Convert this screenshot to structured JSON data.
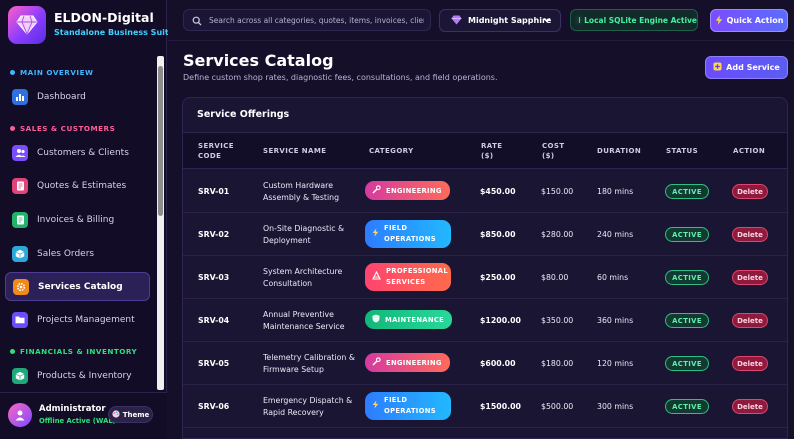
{
  "brand": {
    "name": "ELDON-Digital",
    "subtitle": "Standalone Business Suite"
  },
  "sidebar": {
    "sections": [
      {
        "label": "MAIN OVERVIEW",
        "color": "#3fb6ff"
      },
      {
        "label": "SALES & CUSTOMERS",
        "color": "#ff5e9a"
      },
      {
        "label": "FINANCIALS & INVENTORY",
        "color": "#2ee07a"
      }
    ],
    "items": [
      {
        "label": "Dashboard",
        "icon": "chart-bar-icon",
        "color": "#2f6fe0"
      },
      {
        "label": "Customers & Clients",
        "icon": "users-icon",
        "color": "#7b4dff"
      },
      {
        "label": "Quotes & Estimates",
        "icon": "document-icon",
        "color": "#e0457a"
      },
      {
        "label": "Invoices & Billing",
        "icon": "invoice-icon",
        "color": "#23b26a"
      },
      {
        "label": "Sales Orders",
        "icon": "box-icon",
        "color": "#2aa8d8"
      },
      {
        "label": "Services Catalog",
        "icon": "gear-icon",
        "color": "#f08a1c",
        "active": true
      },
      {
        "label": "Projects Management",
        "icon": "folder-icon",
        "color": "#6b4dff"
      },
      {
        "label": "Products & Inventory",
        "icon": "package-icon",
        "color": "#1fa87a"
      }
    ],
    "user": {
      "name": "Administrator",
      "status": "Offline Active (WAL)",
      "theme_label": "Theme"
    }
  },
  "topbar": {
    "search_placeholder": "Search across all categories, quotes, items, invoices, clients...",
    "theme_name": "Midnight Sapphire",
    "engine_status": "Local SQLite Engine Active",
    "quick_action": "Quick Action"
  },
  "page": {
    "title": "Services Catalog",
    "subtitle": "Define custom shop rates, diagnostic fees, consultations, and field operations.",
    "add_button": "Add Service"
  },
  "table": {
    "title": "Service Offerings",
    "columns": [
      "SERVICE CODE",
      "SERVICE NAME",
      "CATEGORY",
      "RATE ($)",
      "COST ($)",
      "DURATION",
      "STATUS",
      "ACTION"
    ],
    "rows": [
      {
        "code": "SRV-01",
        "name": "Custom Hardware Assembly & Testing",
        "category": "ENGINEERING",
        "cat_style": "engineering",
        "rate": "$450.00",
        "cost": "$150.00",
        "duration": "180 mins",
        "status": "ACTIVE",
        "action": "Delete"
      },
      {
        "code": "SRV-02",
        "name": "On-Site Diagnostic & Deployment",
        "category": "FIELD OPERATIONS",
        "cat_style": "field",
        "rate": "$850.00",
        "cost": "$280.00",
        "duration": "240 mins",
        "status": "ACTIVE",
        "action": "Delete"
      },
      {
        "code": "SRV-03",
        "name": "System Architecture Consultation",
        "category": "PROFESSIONAL SERVICES",
        "cat_style": "professional",
        "rate": "$250.00",
        "cost": "$80.00",
        "duration": "60 mins",
        "status": "ACTIVE",
        "action": "Delete"
      },
      {
        "code": "SRV-04",
        "name": "Annual Preventive Maintenance Service",
        "category": "MAINTENANCE",
        "cat_style": "maintenance",
        "rate": "$1200.00",
        "cost": "$350.00",
        "duration": "360 mins",
        "status": "ACTIVE",
        "action": "Delete"
      },
      {
        "code": "SRV-05",
        "name": "Telemetry Calibration & Firmware Setup",
        "category": "ENGINEERING",
        "cat_style": "engineering",
        "rate": "$600.00",
        "cost": "$180.00",
        "duration": "120 mins",
        "status": "ACTIVE",
        "action": "Delete"
      },
      {
        "code": "SRV-06",
        "name": "Emergency Dispatch & Rapid Recovery",
        "category": "FIELD OPERATIONS",
        "cat_style": "field",
        "rate": "$1500.00",
        "cost": "$500.00",
        "duration": "300 mins",
        "status": "ACTIVE",
        "action": "Delete"
      }
    ]
  }
}
